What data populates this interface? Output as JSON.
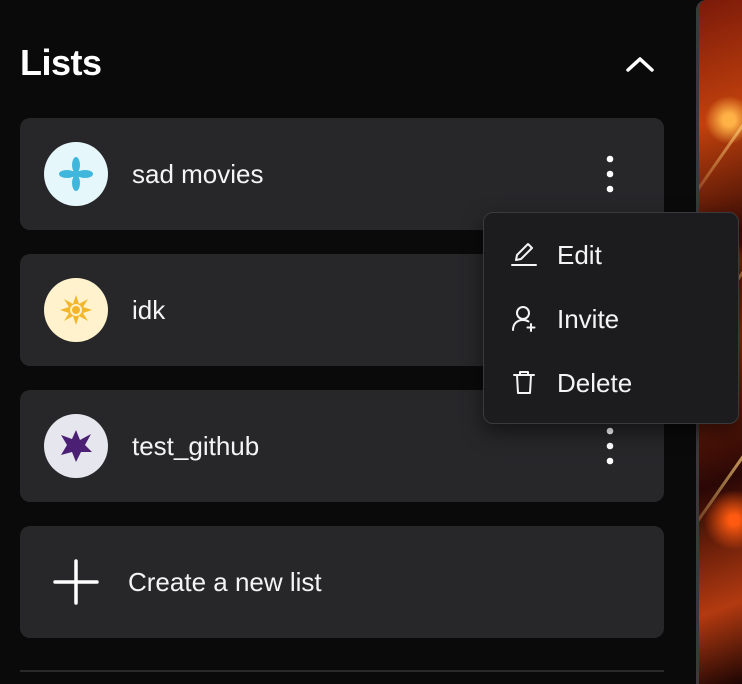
{
  "header": {
    "title": "Lists"
  },
  "lists": [
    {
      "name": "sad movies",
      "icon": "blue-sparkle-icon",
      "avatar_bg": "#e6f7fb",
      "icon_color": "#3fb6dc"
    },
    {
      "name": "idk",
      "icon": "yellow-burst-icon",
      "avatar_bg": "#fff2cc",
      "icon_color": "#f3b62b"
    },
    {
      "name": "test_github",
      "icon": "purple-star-icon",
      "avatar_bg": "#e6e6ee",
      "icon_color": "#4b1f73"
    }
  ],
  "create": {
    "label": "Create a new list",
    "icon": "plus-icon"
  },
  "context_menu": {
    "items": [
      {
        "label": "Edit",
        "icon": "pencil-icon"
      },
      {
        "label": "Invite",
        "icon": "add-user-icon"
      },
      {
        "label": "Delete",
        "icon": "trash-icon"
      }
    ]
  },
  "colors": {
    "background": "#0b0a0a",
    "card": "#27272a",
    "menu": "#1c1c1e",
    "text": "#f4f4f5"
  }
}
